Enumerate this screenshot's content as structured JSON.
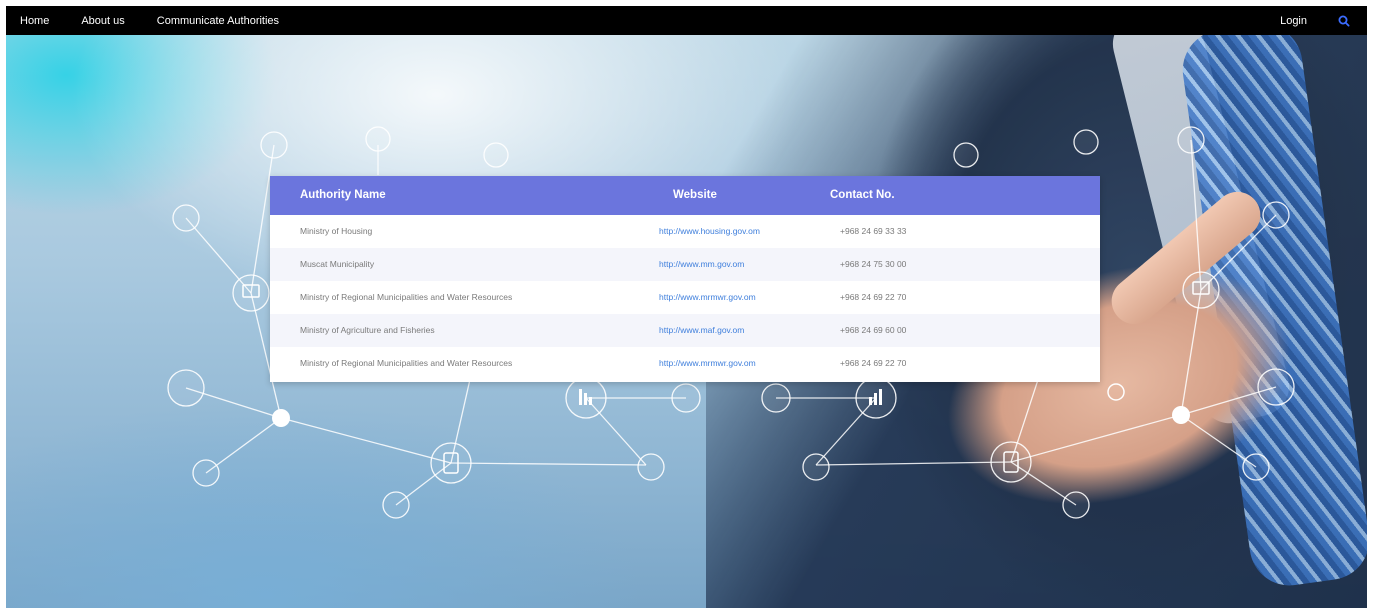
{
  "nav": {
    "left_links": [
      "Home",
      "About us",
      "Communicate Authorities"
    ],
    "login_label": "Login",
    "search_icon": "search-icon"
  },
  "colors": {
    "nav_bg": "#000000",
    "table_header_bg": "#6b75dd",
    "link_color": "#3f7fdc",
    "search_icon_color": "#3b6cff"
  },
  "table": {
    "headers": {
      "name": "Authority Name",
      "website": "Website",
      "contact": "Contact No."
    },
    "rows": [
      {
        "name": "Ministry of Housing",
        "website": "http://www.housing.gov.om",
        "contact": "+968 24 69 33 33"
      },
      {
        "name": "Muscat Municipality",
        "website": "http://www.mm.gov.om",
        "contact": "+968 24 75 30 00"
      },
      {
        "name": "Ministry of Regional Municipalities and Water Resources",
        "website": "http://www.mrmwr.gov.om",
        "contact": "+968 24 69 22 70"
      },
      {
        "name": "Ministry of Agriculture and Fisheries",
        "website": "http://www.maf.gov.om",
        "contact": "+968 24 69 60 00"
      },
      {
        "name": "Ministry of Regional Municipalities and Water Resources",
        "website": "http://www.mrmwr.gov.om",
        "contact": "+968 24 69 22 70"
      }
    ]
  }
}
